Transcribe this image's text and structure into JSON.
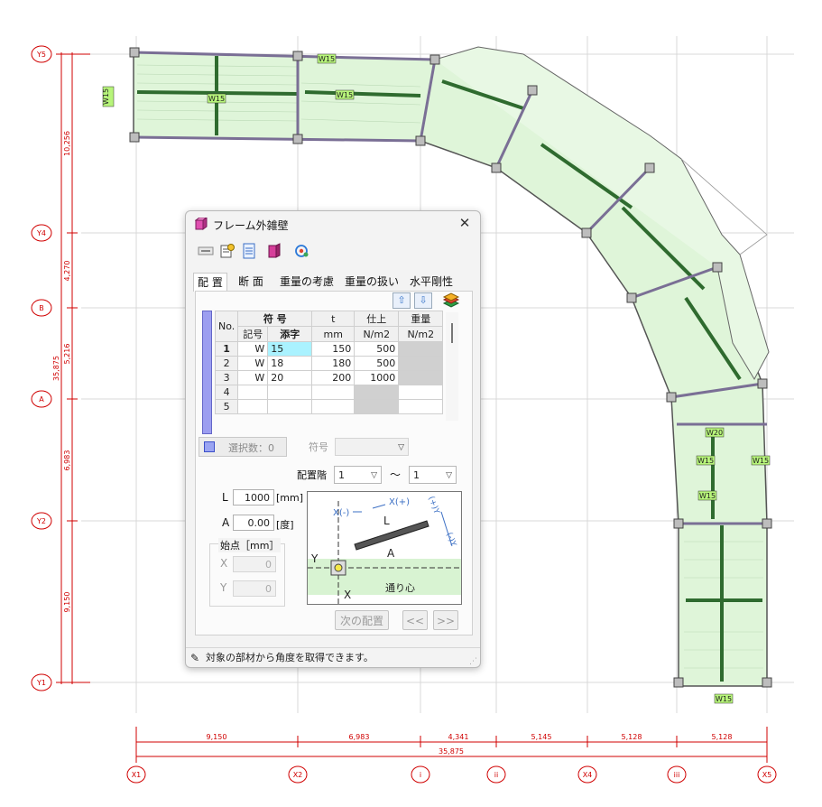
{
  "drawing": {
    "row_axes": [
      "Y5",
      "Y4",
      "B",
      "A",
      "Y2",
      "Y1"
    ],
    "col_axes": [
      "X1",
      "X2",
      "i",
      "ii",
      "X4",
      "iii",
      "X5"
    ],
    "left_dims": [
      "10,256",
      "4,270",
      "5,216",
      "6,983",
      "9,150"
    ],
    "left_total": "35,875",
    "bottom_dims": [
      "9,150",
      "6,983",
      "4,341",
      "5,145",
      "5,128",
      "5,128"
    ],
    "bottom_total": "35,875",
    "wall_tag": "W15",
    "wall_tag_alt": "W20",
    "colors": {
      "axis": "#d00000",
      "floor": "#dff5d9",
      "beam": "#2f6b2f",
      "wall_tag": "#b7f57a"
    }
  },
  "dialog": {
    "title": "フレーム外雑壁",
    "close_label": "✕",
    "toolbar_icons": [
      "frame-link-icon",
      "properties-icon",
      "document-icon",
      "book-icon",
      "target-icon"
    ],
    "tabs": [
      "配 置",
      "断 面",
      "重量の考慮",
      "重量の扱い",
      "水平剛性"
    ],
    "active_tab": "配 置",
    "table": {
      "group_headers": [
        "No.",
        "符 号",
        "t",
        "仕上",
        "重量"
      ],
      "sub_headers": [
        "記号",
        "添字",
        "mm",
        "N/m2",
        "N/m2"
      ],
      "rows": [
        {
          "no": "1",
          "sym": "W",
          "sub": "15",
          "t": "150",
          "fin": "500",
          "wt": ""
        },
        {
          "no": "2",
          "sym": "W",
          "sub": "18",
          "t": "180",
          "fin": "500",
          "wt": ""
        },
        {
          "no": "3",
          "sym": "W",
          "sub": "20",
          "t": "200",
          "fin": "1000",
          "wt": ""
        },
        {
          "no": "4",
          "sym": "",
          "sub": "",
          "t": "",
          "fin": "",
          "wt": ""
        },
        {
          "no": "5",
          "sym": "",
          "sub": "",
          "t": "",
          "fin": "",
          "wt": ""
        }
      ]
    },
    "select_count_label": "選択数：0",
    "symbol_label": "符号",
    "floor_label": "配置階",
    "floor_from": "1",
    "floor_to": "1",
    "range_sep": "〜",
    "L_label": "L",
    "L_value": "1000",
    "L_unit": "[mm]",
    "A_label": "A",
    "A_value": "0.00",
    "A_unit": "[度]",
    "start_label": "始点［mm］",
    "X_label": "X",
    "X_value": "0",
    "Y_label": "Y",
    "Y_value": "0",
    "diagram": {
      "x_minus": "X(-)",
      "x_plus": "X(+)",
      "y_plus": "(+)Y",
      "y_minus": "(-)Y",
      "L": "L",
      "A": "A",
      "Y": "Y",
      "X": "X",
      "center": "通り心"
    },
    "next_button": "次の配置",
    "prev_page": "<<",
    "next_page": ">>",
    "status_text": "対象の部材から角度を取得できます。"
  }
}
